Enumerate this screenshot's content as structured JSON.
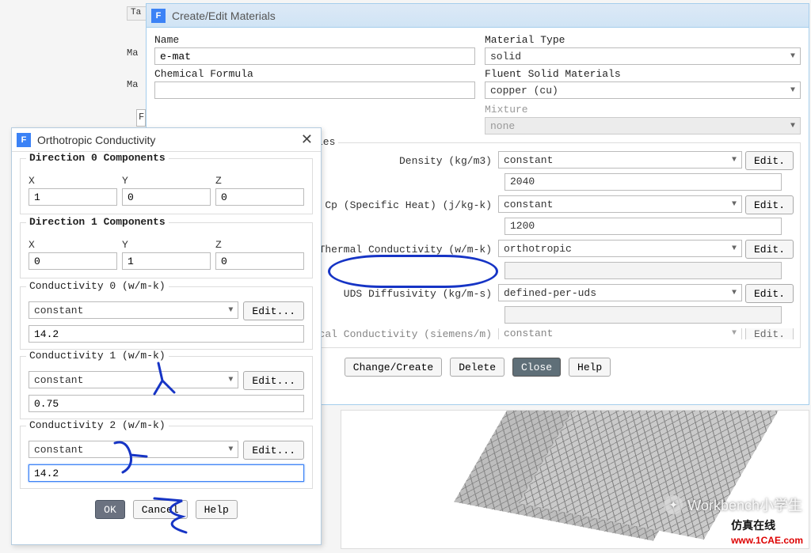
{
  "partial": {
    "ta": "Ta",
    "ies": "ies",
    "f": "F",
    "m1": "Ma",
    "m2": "Ma",
    "elec_label_clip": "trical Conductivity (siemens/m)"
  },
  "main": {
    "title": "Create/Edit Materials",
    "name_label": "Name",
    "name_value": "e-mat",
    "formula_label": "Chemical Formula",
    "formula_value": "",
    "mat_type_label": "Material Type",
    "mat_type_value": "solid",
    "fluent_label": "Fluent Solid Materials",
    "fluent_value": "copper (cu)",
    "mixture_label": "Mixture",
    "mixture_value": "none",
    "props": {
      "density": {
        "label": "Density (kg/m3)",
        "type": "constant",
        "value": "2040"
      },
      "cp": {
        "label": "Cp (Specific Heat) (j/kg-k)",
        "type": "constant",
        "value": "1200"
      },
      "k": {
        "label": "Thermal Conductivity (w/m-k)",
        "type": "orthotropic",
        "value": ""
      },
      "uds": {
        "label": "UDS Diffusivity (kg/m-s)",
        "type": "defined-per-uds",
        "value": ""
      },
      "elec": {
        "type": "constant"
      }
    },
    "edit_btn": "Edit.",
    "buttons": {
      "change": "Change/Create",
      "delete": "Delete",
      "close": "Close",
      "help": "Help"
    }
  },
  "sub": {
    "title": "Orthotropic Conductivity",
    "dir0": "Direction 0 Components",
    "dir1": "Direction 1 Components",
    "x": "X",
    "y": "Y",
    "z": "Z",
    "d0": {
      "x": "1",
      "y": "0",
      "z": "0"
    },
    "d1": {
      "x": "0",
      "y": "1",
      "z": "0"
    },
    "cond0": {
      "label": "Conductivity 0 (w/m-k)",
      "type": "constant",
      "value": "14.2"
    },
    "cond1": {
      "label": "Conductivity 1 (w/m-k)",
      "type": "constant",
      "value": "0.75"
    },
    "cond2": {
      "label": "Conductivity 2 (w/m-k)",
      "type": "constant",
      "value": "14.2"
    },
    "edit": "Edit...",
    "buttons": {
      "ok": "OK",
      "cancel": "Cancel",
      "help": "Help"
    }
  },
  "viewport": {
    "wechat": "Workbench小学生",
    "wm_cn": "仿真在线",
    "wm_url": "www.1CAE.com"
  }
}
